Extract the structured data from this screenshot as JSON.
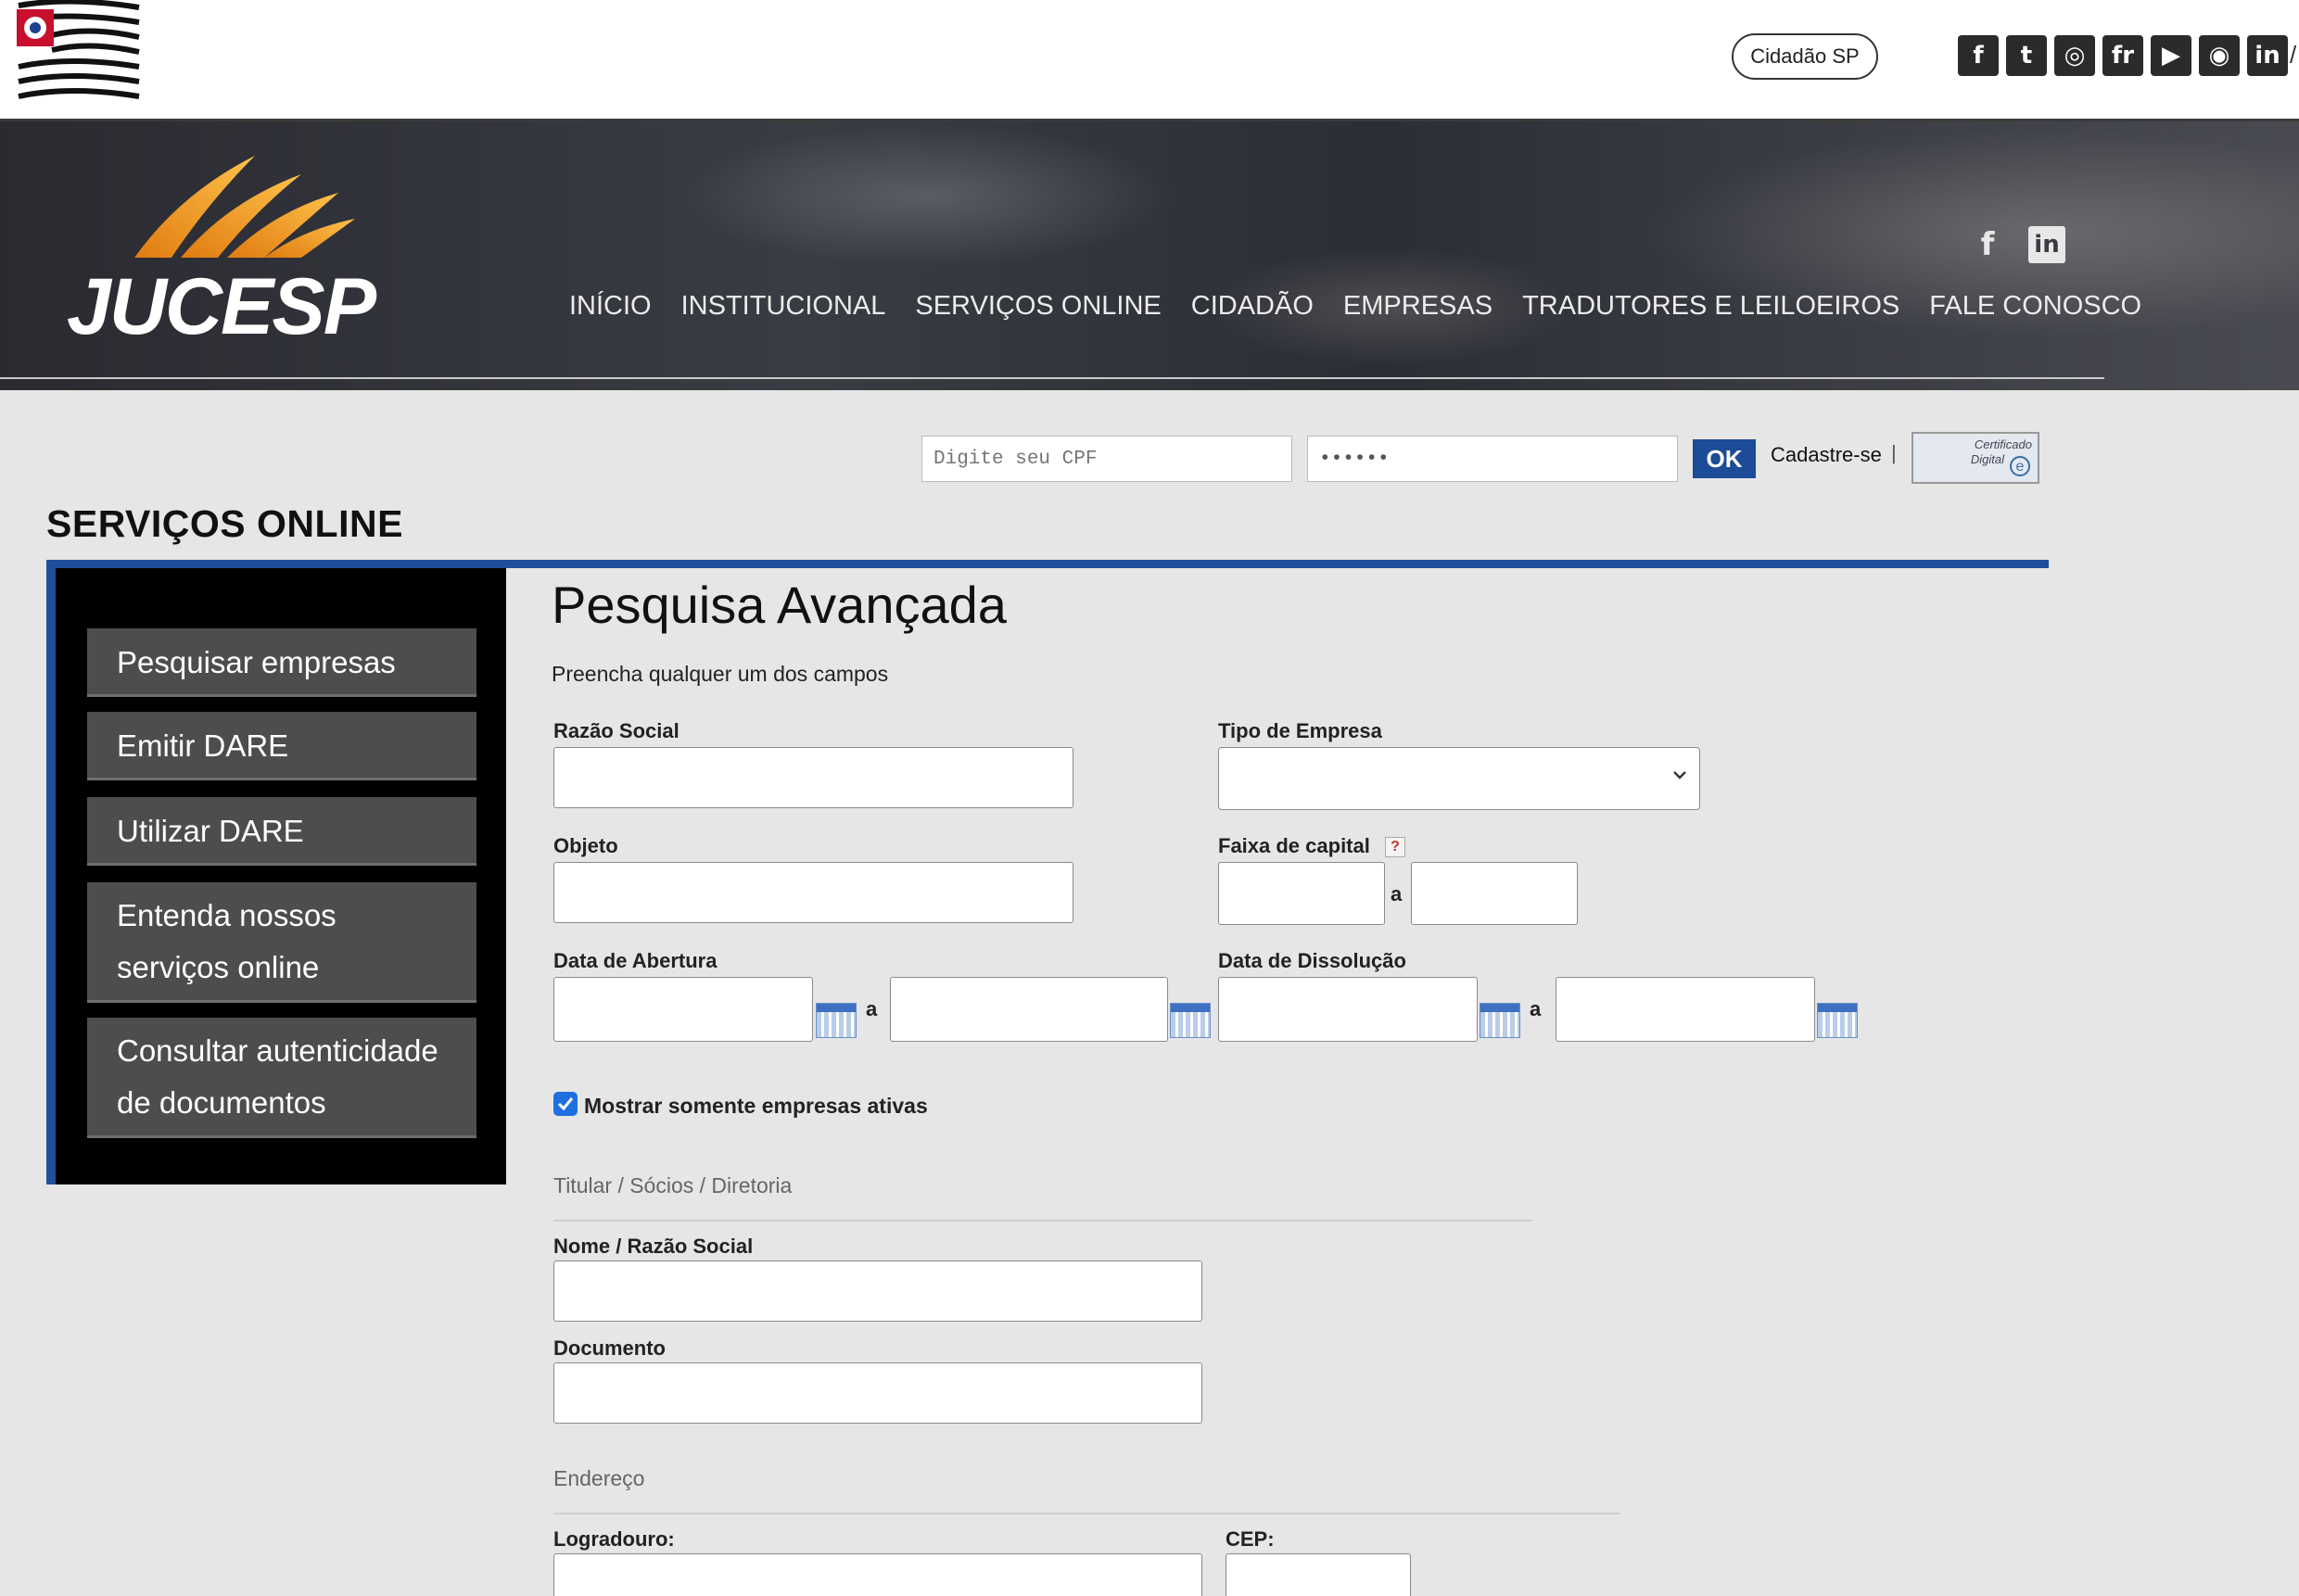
{
  "gov_bar": {
    "cidadao_label": "Cidadão SP",
    "social_icons": [
      "facebook-icon",
      "twitter-icon",
      "instagram-icon",
      "flickr-icon",
      "youtube-icon",
      "periscope-icon",
      "linkedin-icon"
    ],
    "social_glyphs": [
      "f",
      "t",
      "◎",
      "fr",
      "▶",
      "◉",
      "in"
    ],
    "edge_glyph": "/"
  },
  "header": {
    "logo_text": "JUCESP",
    "nav": [
      "INÍCIO",
      "INSTITUCIONAL",
      "SERVIÇOS ONLINE",
      "CIDADÃO",
      "EMPRESAS",
      "TRADUTORES E LEILOEIROS",
      "FALE CONOSCO"
    ],
    "social": {
      "facebook": "f",
      "linkedin": "in"
    }
  },
  "login": {
    "cpf_placeholder": "Digite seu CPF",
    "password_value": "••••••",
    "ok_label": "OK",
    "cadastre_label": "Cadastre-se",
    "separator": "|",
    "cert_line1": "Certificado",
    "cert_line2": "Digital",
    "cert_mark": "e"
  },
  "section": {
    "title": "SERVIÇOS ONLINE",
    "sidebar": [
      "Pesquisar empresas",
      "Emitir DARE",
      "Utilizar DARE",
      "Entenda nossos serviços online",
      "Consultar autenticidade de documentos"
    ]
  },
  "form": {
    "title": "Pesquisa Avançada",
    "hint": "Preencha qualquer um dos campos",
    "razao_social": "Razão Social",
    "tipo_empresa": "Tipo de Empresa",
    "objeto": "Objeto",
    "faixa_capital": "Faixa de capital",
    "help_glyph": "?",
    "range_sep": "a",
    "data_abertura": "Data de Abertura",
    "data_dissolucao": "Data de Dissolução",
    "somente_ativas": "Mostrar somente empresas ativas",
    "somente_ativas_checked": true,
    "titular_heading": "Titular / Sócios / Diretoria",
    "nome_razao": "Nome / Razão Social",
    "documento": "Documento",
    "endereco_heading": "Endereço",
    "logradouro": "Logradouro:",
    "cep": "CEP:"
  },
  "colors": {
    "brand_blue": "#1f4f9b",
    "logo_orange": "#f0a020",
    "sidebar_item": "#4d4d4d"
  }
}
